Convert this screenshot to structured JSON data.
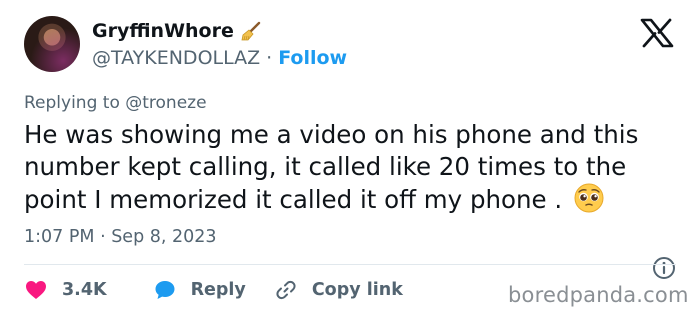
{
  "user": {
    "display_name": "GryffinWhore",
    "handle": "@TAYKENDOLLAZ",
    "separator": "·",
    "follow_label": "Follow"
  },
  "reply": {
    "prefix": "Replying to",
    "mention": "@troneze"
  },
  "tweet": {
    "text": "He was showing me a video on his phone and this number kept calling, it called like 20 times to the point I memorized it called it off my phone . ",
    "emoji": "pleading-face"
  },
  "meta": {
    "time_date": "1:07 PM · Sep 8, 2023"
  },
  "actions": {
    "like_count": "3.4K",
    "reply_label": "Reply",
    "copy_label": "Copy link"
  },
  "watermark": "boredpanda.com",
  "colors": {
    "accent": "#1d9bf0",
    "like": "#f91880",
    "text": "#0f1419",
    "muted": "#536471"
  },
  "icons": [
    "broom-icon",
    "x-logo-icon",
    "pleading-face-emoji",
    "info-icon",
    "heart-icon",
    "reply-bubble-icon",
    "link-icon"
  ]
}
